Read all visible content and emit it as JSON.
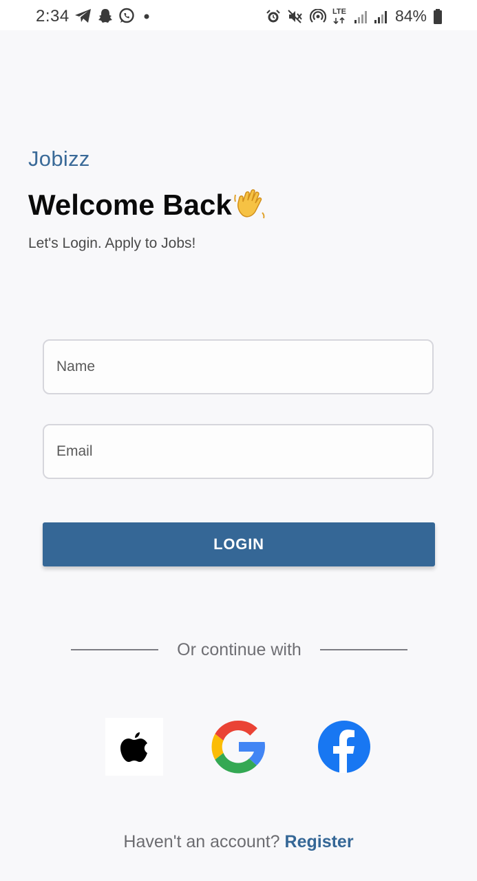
{
  "status_bar": {
    "time": "2:34",
    "battery": "84%",
    "icons_left": [
      "telegram-icon",
      "snapchat-icon",
      "whatsapp-icon",
      "dot-icon"
    ],
    "icons_right": [
      "alarm-icon",
      "mute-icon",
      "hotspot-icon",
      "lte-icon",
      "signal-icon",
      "signal-icon",
      "battery-icon"
    ],
    "network_label": "LTE"
  },
  "header": {
    "brand": "Jobizz",
    "title": "Welcome Back",
    "title_emoji": "waving-hand-icon",
    "subtitle": "Let's Login. Apply to Jobs!"
  },
  "form": {
    "name_placeholder": "Name",
    "email_placeholder": "Email",
    "login_label": "LOGIN"
  },
  "divider": {
    "text": "Or continue with"
  },
  "social": {
    "apple": "apple-icon",
    "google": "google-icon",
    "facebook": "facebook-icon"
  },
  "footer": {
    "prompt": "Haven't an account?",
    "register_label": "Register"
  },
  "colors": {
    "accent": "#356796",
    "brand_text": "#3a6a98",
    "background": "#f8f8fa",
    "facebook_blue": "#1877f2"
  }
}
